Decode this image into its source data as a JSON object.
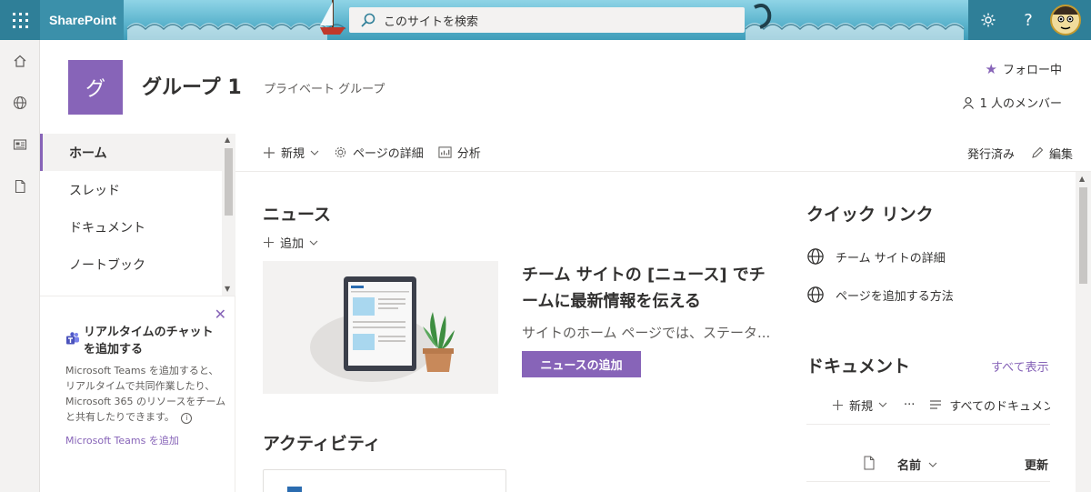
{
  "suitebar": {
    "app_name": "SharePoint",
    "search_placeholder": "このサイトを検索",
    "settings_icon": "gear-icon",
    "help_label": "?"
  },
  "site": {
    "logo_letter": "グ",
    "title": "グループ 1",
    "subtitle": "プライベート グループ",
    "follow_label": "フォロー中",
    "members_label": "1 人のメンバー"
  },
  "nav": {
    "items": [
      {
        "label": "ホーム",
        "active": true
      },
      {
        "label": "スレッド",
        "active": false
      },
      {
        "label": "ドキュメント",
        "active": false
      },
      {
        "label": "ノートブック",
        "active": false
      }
    ]
  },
  "teams_card": {
    "title": "リアルタイムのチャットを追加する",
    "body": "Microsoft Teams を追加すると、リアルタイムで共同作業したり、Microsoft 365 のリソースをチームと共有したりできます。",
    "info": "i",
    "link": "Microsoft Teams を追加"
  },
  "commandbar": {
    "new_label": "新規",
    "page_details_label": "ページの詳細",
    "analytics_label": "分析",
    "status_label": "発行済み",
    "edit_label": "編集"
  },
  "news": {
    "title": "ニュース",
    "add_label": "追加",
    "headline": "チーム サイトの [ニュース] でチームに最新情報を伝える",
    "description": "サイトのホーム ページでは、ステータ...",
    "button_label": "ニュースの追加"
  },
  "activity": {
    "title": "アクティビティ"
  },
  "quick_links": {
    "title": "クイック リンク",
    "items": [
      {
        "label": "チーム サイトの詳細"
      },
      {
        "label": "ページを追加する方法"
      }
    ]
  },
  "documents": {
    "title": "ドキュメント",
    "view_all": "すべて表示",
    "new_label": "新規",
    "more_label": "···",
    "view_label": "すべてのドキュメント",
    "col_name": "名前",
    "col_modified": "更新"
  },
  "colors": {
    "accent": "#8764b8",
    "suitebar": "#3f9db9"
  }
}
